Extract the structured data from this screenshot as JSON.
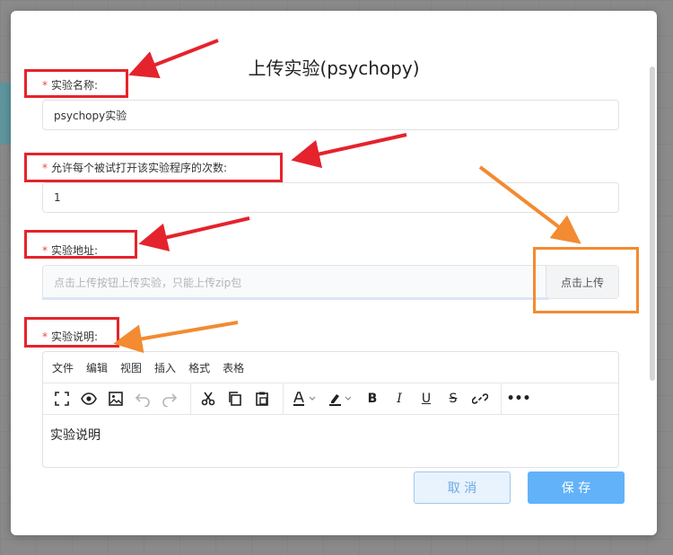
{
  "modal": {
    "title": "上传实验(psychopy)",
    "fields": {
      "name_label": "实验名称:",
      "name_value": "psychopy实验",
      "times_label": "允许每个被试打开该实验程序的次数:",
      "times_value": "1",
      "address_label": "实验地址:",
      "address_placeholder": "点击上传按钮上传实验，只能上传zip包",
      "upload_button": "点击上传",
      "description_label": "实验说明:"
    },
    "required_mark": "*",
    "editor": {
      "menu": [
        "文件",
        "编辑",
        "视图",
        "插入",
        "格式",
        "表格"
      ],
      "content": "实验说明",
      "toolbar_icons": [
        "fullscreen-icon",
        "preview-icon",
        "image-icon",
        "undo-icon",
        "redo-icon",
        "cut-icon",
        "copy-icon",
        "paste-icon",
        "text-color-icon",
        "highlight-color-icon",
        "bold-icon",
        "italic-icon",
        "underline-icon",
        "strikethrough-icon",
        "link-icon",
        "more-icon"
      ]
    },
    "buttons": {
      "cancel": "取 消",
      "save": "保 存"
    }
  },
  "colors": {
    "primary": "#62b2f9",
    "required": "#e74c3c",
    "annotation_red": "#e5232d",
    "annotation_orange": "#f28b31"
  }
}
